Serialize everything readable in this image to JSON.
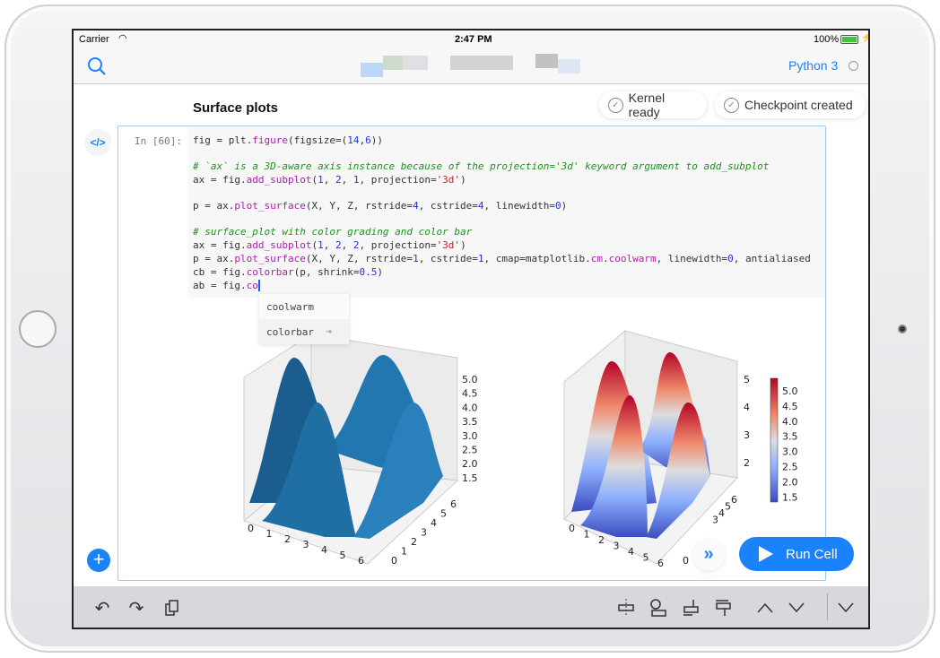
{
  "status": {
    "carrier": "Carrier",
    "time": "2:47 PM",
    "battery": "100%"
  },
  "nav": {
    "kernel": "Python 3"
  },
  "notebook": {
    "heading": "Surface plots",
    "kernel_status": "Kernel ready",
    "checkpoint_status": "Checkpoint created"
  },
  "cell": {
    "prompt": "In [60]:"
  },
  "autocomplete": [
    "coolwarm",
    "colorbar"
  ],
  "run_button": "Run Cell",
  "colors": {
    "accent": "#1a82fb",
    "surface": "#1f77b4"
  },
  "plot1": {
    "zticks": [
      "5.0",
      "4.5",
      "4.0",
      "3.5",
      "3.0",
      "2.5",
      "2.0",
      "1.5"
    ],
    "xticks": [
      "0",
      "1",
      "2",
      "3",
      "4",
      "5",
      "6"
    ],
    "yticks": [
      "0",
      "1",
      "2",
      "3",
      "4",
      "5",
      "6"
    ]
  },
  "plot2": {
    "zticks": [
      "5",
      "4",
      "3",
      "2"
    ],
    "xticks": [
      "0",
      "1",
      "2",
      "3",
      "4",
      "5",
      "6"
    ],
    "yticks": [
      "0",
      "3",
      "4",
      "5",
      "6"
    ],
    "colorbar_ticks": [
      "5.0",
      "4.5",
      "4.0",
      "3.5",
      "3.0",
      "2.5",
      "2.0",
      "1.5"
    ]
  }
}
